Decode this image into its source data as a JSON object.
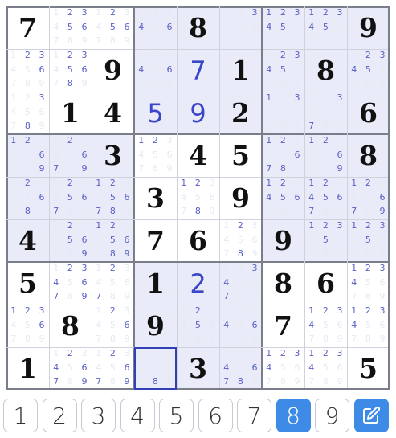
{
  "board": {
    "givens": [
      [
        "7",
        "",
        "",
        "",
        "8",
        "",
        "",
        "",
        "9"
      ],
      [
        "",
        "",
        "9",
        "",
        "",
        "1",
        "",
        "8",
        ""
      ],
      [
        "",
        "1",
        "4",
        "",
        "",
        "2",
        "",
        "",
        "6"
      ],
      [
        "",
        "",
        "3",
        "",
        "4",
        "5",
        "",
        "",
        "8"
      ],
      [
        "",
        "",
        "",
        "3",
        "",
        "9",
        "",
        "",
        ""
      ],
      [
        "4",
        "",
        "",
        "7",
        "6",
        "",
        "9",
        "",
        ""
      ],
      [
        "5",
        "",
        "",
        "1",
        "",
        "",
        "8",
        "6",
        ""
      ],
      [
        "",
        "8",
        "",
        "9",
        "",
        "",
        "7",
        "",
        ""
      ],
      [
        "1",
        "",
        "",
        "",
        "3",
        "",
        "",
        "",
        "5"
      ]
    ],
    "user_entries": [
      [
        "",
        "",
        "",
        "",
        "",
        "",
        "",
        "",
        ""
      ],
      [
        "",
        "",
        "",
        "",
        "7",
        "",
        "",
        "",
        ""
      ],
      [
        "",
        "",
        "",
        "5",
        "9",
        "",
        "",
        "",
        ""
      ],
      [
        "",
        "",
        "",
        "",
        "",
        "",
        "",
        "",
        ""
      ],
      [
        "",
        "",
        "",
        "",
        "",
        "",
        "",
        "",
        ""
      ],
      [
        "",
        "",
        "",
        "",
        "",
        "",
        "",
        "",
        ""
      ],
      [
        "",
        "",
        "",
        "",
        "2",
        "",
        "",
        "",
        ""
      ],
      [
        "",
        "",
        "",
        "",
        "",
        "",
        "",
        "",
        ""
      ],
      [
        "",
        "",
        "",
        "",
        "",
        "",
        "",
        "",
        ""
      ]
    ],
    "candidates": [
      [
        [],
        [
          2,
          3,
          5,
          6
        ],
        [
          2,
          5,
          6
        ],
        [
          4,
          6
        ],
        [],
        [
          3
        ],
        [
          1,
          2,
          3,
          4,
          5
        ],
        [
          1,
          2,
          3,
          4,
          5
        ],
        []
      ],
      [
        [
          2,
          3,
          6
        ],
        [
          2,
          3,
          5,
          6,
          8
        ],
        [],
        [
          4,
          6
        ],
        [],
        [],
        [
          2,
          3,
          4,
          5
        ],
        [],
        [
          2,
          3,
          4,
          5
        ]
      ],
      [
        [
          3,
          8
        ],
        [],
        [],
        [],
        [],
        [],
        [
          1,
          3
        ],
        [
          3,
          7
        ],
        []
      ],
      [
        [
          1,
          2,
          6,
          9
        ],
        [
          2,
          6,
          7,
          9
        ],
        [],
        [
          1,
          2
        ],
        [],
        [],
        [
          1,
          2,
          6,
          7,
          8
        ],
        [
          1,
          2,
          6,
          9
        ],
        []
      ],
      [
        [
          2,
          6,
          8
        ],
        [
          2,
          5,
          6,
          7
        ],
        [
          1,
          2,
          5,
          6,
          7,
          8
        ],
        [],
        [
          1,
          2,
          8
        ],
        [],
        [
          1,
          2,
          4,
          5,
          6
        ],
        [
          1,
          2,
          4,
          5,
          6,
          7
        ],
        [
          1,
          2,
          6,
          7,
          9
        ]
      ],
      [
        [],
        [
          2,
          5,
          6,
          9
        ],
        [
          1,
          2,
          5,
          6,
          8,
          9
        ],
        [],
        [],
        [
          2,
          8
        ],
        [],
        [
          1,
          2,
          3,
          5
        ],
        [
          1,
          2,
          3,
          5
        ]
      ],
      [
        [],
        [
          2,
          3,
          4,
          6,
          7,
          9
        ],
        [
          2,
          7
        ],
        [],
        [],
        [
          3,
          4,
          7
        ],
        [],
        [],
        [
          1,
          2,
          3,
          4
        ]
      ],
      [
        [
          1,
          2,
          3,
          6
        ],
        [],
        [
          2,
          6
        ],
        [],
        [
          2,
          5
        ],
        [
          4,
          6
        ],
        [],
        [
          1,
          2,
          3,
          4
        ],
        [
          1,
          2,
          3,
          4
        ]
      ],
      [
        [],
        [
          2,
          4,
          6,
          7,
          9
        ],
        [
          2,
          6,
          7,
          9
        ],
        [
          8
        ],
        [],
        [
          4,
          6,
          7,
          8
        ],
        [
          1,
          2,
          3,
          4
        ],
        [
          1,
          2,
          3,
          4
        ],
        []
      ]
    ],
    "highlighted_cells": [
      [
        0,
        3
      ],
      [
        0,
        4
      ],
      [
        0,
        5
      ],
      [
        1,
        3
      ],
      [
        1,
        4
      ],
      [
        1,
        5
      ],
      [
        2,
        3
      ],
      [
        2,
        4
      ],
      [
        2,
        5
      ],
      [
        0,
        6
      ],
      [
        0,
        7
      ],
      [
        0,
        8
      ],
      [
        1,
        6
      ],
      [
        1,
        7
      ],
      [
        1,
        8
      ],
      [
        2,
        6
      ],
      [
        2,
        7
      ],
      [
        2,
        8
      ],
      [
        3,
        0
      ],
      [
        3,
        1
      ],
      [
        3,
        2
      ],
      [
        4,
        0
      ],
      [
        4,
        1
      ],
      [
        4,
        2
      ],
      [
        5,
        0
      ],
      [
        5,
        1
      ],
      [
        5,
        2
      ],
      [
        3,
        6
      ],
      [
        3,
        7
      ],
      [
        3,
        8
      ],
      [
        4,
        6
      ],
      [
        4,
        7
      ],
      [
        4,
        8
      ],
      [
        5,
        6
      ],
      [
        5,
        7
      ],
      [
        5,
        8
      ],
      [
        6,
        3
      ],
      [
        6,
        4
      ],
      [
        6,
        5
      ],
      [
        7,
        3
      ],
      [
        7,
        4
      ],
      [
        7,
        5
      ],
      [
        8,
        3
      ],
      [
        8,
        4
      ],
      [
        8,
        5
      ]
    ],
    "selected_cell": [
      8,
      3
    ]
  },
  "numpad": {
    "digits": [
      "1",
      "2",
      "3",
      "4",
      "5",
      "6",
      "7",
      "8",
      "9"
    ],
    "active_digit": "8",
    "edit_icon": "pencil-edit-icon"
  },
  "colors": {
    "accent": "#3d8be6",
    "user_digit": "#3a45c8",
    "candidate": "#5a60c6",
    "highlight": "#e9ecf8",
    "selection": "#3340b5"
  }
}
